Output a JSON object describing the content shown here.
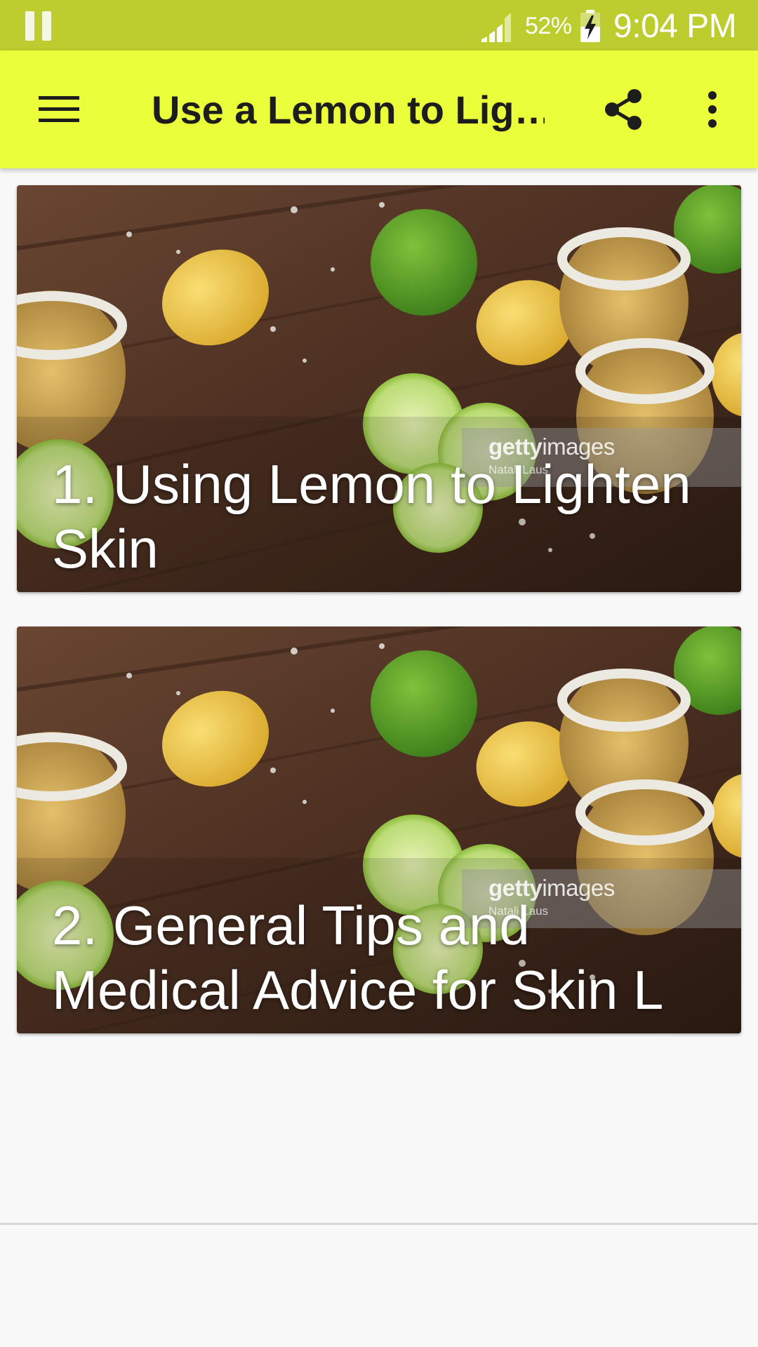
{
  "status_bar": {
    "battery_percent": "52%",
    "time": "9:04 PM",
    "icons": [
      "pause-icon",
      "signal-icon",
      "battery-charging-icon"
    ]
  },
  "app_bar": {
    "title": "Use a Lemon to Lig…",
    "icons": [
      "menu-icon",
      "share-icon",
      "more-vert-icon"
    ]
  },
  "cards": [
    {
      "title": "1. Using Lemon to Lighten Skin",
      "watermark_brand_bold": "getty",
      "watermark_brand_rest": "images",
      "watermark_credit": "Natali Laus"
    },
    {
      "title": "2. General Tips and Medical Advice for Skin L",
      "watermark_brand_bold": "getty",
      "watermark_brand_rest": "images",
      "watermark_credit": "Natali Laus"
    }
  ],
  "colors": {
    "status_bar": "#bdcc2f",
    "app_bar": "#eaff3a",
    "background": "#f8f8f8",
    "title_text": "#1d1d1d"
  }
}
